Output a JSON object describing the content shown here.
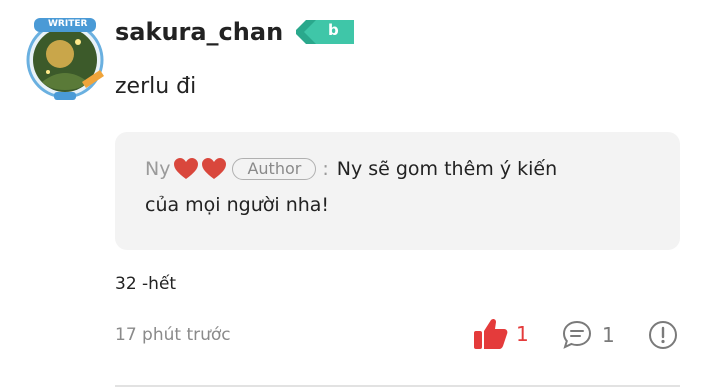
{
  "comment": {
    "username": "sakura_chan",
    "badge_letter": "b",
    "avatar_label": "WRITER",
    "text": "zerlu đi",
    "note": "32 -hết",
    "time": "17 phút trước",
    "like_count": "1",
    "reply_count": "1"
  },
  "reply": {
    "name": "Ny",
    "author_tag": "Author",
    "separator": ":",
    "text_line1": "Ny sẽ gom thêm ý kiến",
    "text_line2": "của mọi người nha!"
  },
  "colors": {
    "like": "#e43b3b",
    "badge": "#3fc6a8",
    "reply_bg": "#f3f3f3"
  }
}
